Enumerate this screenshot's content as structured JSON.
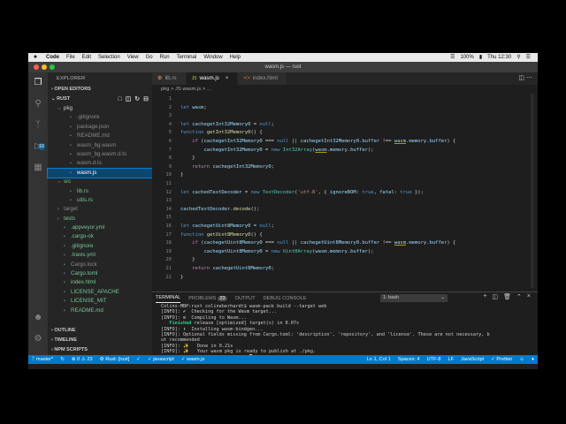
{
  "menubar": {
    "items": [
      "Code",
      "File",
      "Edit",
      "Selection",
      "View",
      "Go",
      "Run",
      "Terminal",
      "Window",
      "Help"
    ],
    "battery": "100%",
    "time": "Thu 12:30"
  },
  "window": {
    "title": "wasm.js — rust"
  },
  "sidebar": {
    "header": "EXPLORER",
    "open_editors": "OPEN EDITORS",
    "root": "RUST",
    "tree": [
      {
        "label": "pkg",
        "depth": 1,
        "type": "folder-open",
        "color": "#cccccc"
      },
      {
        "label": ".gitignore",
        "depth": 2,
        "type": "file",
        "color": "#8a8a8a"
      },
      {
        "label": "package.json",
        "depth": 2,
        "type": "file",
        "color": "#8a8a8a"
      },
      {
        "label": "README.md",
        "depth": 2,
        "type": "file",
        "color": "#8a8a8a"
      },
      {
        "label": "wasm_bg.wasm",
        "depth": 2,
        "type": "file",
        "color": "#8a8a8a"
      },
      {
        "label": "wasm_bg.wasm.d.ts",
        "depth": 2,
        "type": "file",
        "color": "#8a8a8a"
      },
      {
        "label": "wasm.d.ts",
        "depth": 2,
        "type": "file",
        "color": "#8a8a8a"
      },
      {
        "label": "wasm.js",
        "depth": 2,
        "type": "file",
        "color": "#ffffff",
        "selected": true
      },
      {
        "label": "src",
        "depth": 1,
        "type": "folder-open",
        "color": "#73c991"
      },
      {
        "label": "lib.rs",
        "depth": 2,
        "type": "file",
        "color": "#73c991"
      },
      {
        "label": "utils.rs",
        "depth": 2,
        "type": "file",
        "color": "#73c991"
      },
      {
        "label": "target",
        "depth": 1,
        "type": "folder",
        "color": "#8a8a8a"
      },
      {
        "label": "tests",
        "depth": 1,
        "type": "folder",
        "color": "#73c991"
      },
      {
        "label": ".appveyor.yml",
        "depth": 1,
        "type": "file",
        "color": "#73c991"
      },
      {
        "label": ".cargo-ok",
        "depth": 1,
        "type": "file",
        "color": "#73c991"
      },
      {
        "label": ".gitignore",
        "depth": 1,
        "type": "file",
        "color": "#73c991"
      },
      {
        "label": ".travis.yml",
        "depth": 1,
        "type": "file",
        "color": "#73c991"
      },
      {
        "label": "Cargo.lock",
        "depth": 1,
        "type": "file",
        "color": "#8a8a8a"
      },
      {
        "label": "Cargo.toml",
        "depth": 1,
        "type": "file",
        "color": "#73c991"
      },
      {
        "label": "index.html",
        "depth": 1,
        "type": "file",
        "color": "#73c991"
      },
      {
        "label": "LICENSE_APACHE",
        "depth": 1,
        "type": "file",
        "color": "#73c991"
      },
      {
        "label": "LICENSE_MIT",
        "depth": 1,
        "type": "file",
        "color": "#73c991"
      },
      {
        "label": "README.md",
        "depth": 1,
        "type": "file",
        "color": "#73c991"
      }
    ],
    "outline": "OUTLINE",
    "timeline": "TIMELINE",
    "npm_scripts": "NPM SCRIPTS"
  },
  "editor": {
    "tabs": [
      {
        "label": "lib.rs",
        "active": false
      },
      {
        "label": "wasm.js",
        "active": true
      },
      {
        "label": "index.html",
        "active": false
      }
    ],
    "breadcrumb": "pkg > JS wasm.js > ...",
    "lines": [
      {
        "n": "1",
        "html": ""
      },
      {
        "n": "2",
        "html": "<span class='kw'>let</span> <span class='var'>wasm</span>;"
      },
      {
        "n": "3",
        "html": ""
      },
      {
        "n": "4",
        "html": "<span class='kw'>let</span> <span class='var'>cachegetInt32Memory0</span> = <span class='kw'>null</span>;"
      },
      {
        "n": "5",
        "html": "<span class='kw'>function</span> <span class='fn'>getInt32Memory0</span>() {"
      },
      {
        "n": "6",
        "html": "    <span class='kw2'>if</span> (<span class='var'>cachegetInt32Memory0</span> === <span class='kw'>null</span> || <span class='var'>cachegetInt32Memory0</span>.<span class='var'>buffer</span> !== <span class='var und'>wasm</span>.<span class='var'>memory</span>.<span class='var'>buffer</span>) {"
      },
      {
        "n": "7",
        "html": "        <span class='var'>cachegetInt32Memory0</span> = <span class='kw'>new</span> <span class='ty'>Int32Array</span>(<span class='var und'>wasm</span>.<span class='var'>memory</span>.<span class='var'>buffer</span>);"
      },
      {
        "n": "8",
        "html": "    }"
      },
      {
        "n": "9",
        "html": "    <span class='kw2'>return</span> <span class='var'>cachegetInt32Memory0</span>;"
      },
      {
        "n": "10",
        "html": "}"
      },
      {
        "n": "11",
        "html": ""
      },
      {
        "n": "12",
        "html": "<span class='kw'>let</span> <span class='var'>cachedTextDecoder</span> = <span class='kw'>new</span> <span class='ty'>TextDecoder</span>(<span class='str'>'utf-8'</span>, { <span class='var'>ignoreBOM</span>: <span class='kw'>true</span>, <span class='var'>fatal</span>: <span class='kw'>true</span> });"
      },
      {
        "n": "13",
        "html": ""
      },
      {
        "n": "14",
        "html": "<span class='var'>cachedTextDecoder</span>.<span class='fn'>decode</span>();"
      },
      {
        "n": "15",
        "html": ""
      },
      {
        "n": "16",
        "html": "<span class='kw'>let</span> <span class='var'>cachegetUint8Memory0</span> = <span class='kw'>null</span>;"
      },
      {
        "n": "17",
        "html": "<span class='kw'>function</span> <span class='fn'>getUint8Memory0</span>() {"
      },
      {
        "n": "18",
        "html": "    <span class='kw2'>if</span> (<span class='var'>cachegetUint8Memory0</span> === <span class='kw'>null</span> || <span class='var'>cachegetUint8Memory0</span>.<span class='var'>buffer</span> !== <span class='var und'>wasm</span>.<span class='var'>memory</span>.<span class='var'>buffer</span>) {"
      },
      {
        "n": "19",
        "html": "        <span class='var'>cachegetUint8Memory0</span> = <span class='kw'>new</span> <span class='ty'>Uint8Array</span>(<span class='var'>wasm</span>.<span class='var'>memory</span>.<span class='var'>buffer</span>);"
      },
      {
        "n": "20",
        "html": "    }"
      },
      {
        "n": "21",
        "html": "    <span class='kw2'>return</span> <span class='var'>cachegetUint8Memory0</span>;"
      },
      {
        "n": "22",
        "html": "}"
      }
    ]
  },
  "panel": {
    "tabs": [
      {
        "label": "TERMINAL",
        "active": true
      },
      {
        "label": "PROBLEMS",
        "active": false,
        "badge": "23"
      },
      {
        "label": "OUTPUT",
        "active": false
      },
      {
        "label": "DEBUG CONSOLE",
        "active": false
      }
    ],
    "terminal_select": "1: bash",
    "lines": [
      {
        "text": "Colins-MBP:rust colineberhardt$ wasm-pack build --target web"
      },
      {
        "text": "[INFO]: ✔  Checking for the Wasm target..."
      },
      {
        "text": "[INFO]: ⚙  Compiling to Wasm..."
      },
      {
        "text": "   Finished release [optimized] target(s) in 0.07s",
        "green": "Finished"
      },
      {
        "text": "[INFO]: ⬇  Installing wasm-bindgen..."
      },
      {
        "text": "[INFO]: Optional fields missing from Cargo.toml: 'description', 'repository', and 'license'. These are not necessary, b"
      },
      {
        "text": "ut recommended"
      },
      {
        "text": "[INFO]: ✨   Done in 0.21s"
      },
      {
        "text": "[INFO]: ✨   Your wasm pkg is ready to publish at ./pkg."
      },
      {
        "text": "Colins-MBP:rust colineberhardt$ █"
      }
    ]
  },
  "status": {
    "branch": "master*",
    "errors": "0",
    "warnings": "23",
    "rust": "Rust: [rust]",
    "lang_file1": "javascript",
    "lang_file2": "wasm.js",
    "position": "Ln 1, Col 1",
    "spaces": "Spaces: 4",
    "encoding": "UTF-8",
    "eol": "LF",
    "language": "JavaScript",
    "prettier": "Prettier"
  },
  "colors": {
    "accent": "#007acc",
    "selection": "#094771",
    "git_added": "#73c991"
  }
}
